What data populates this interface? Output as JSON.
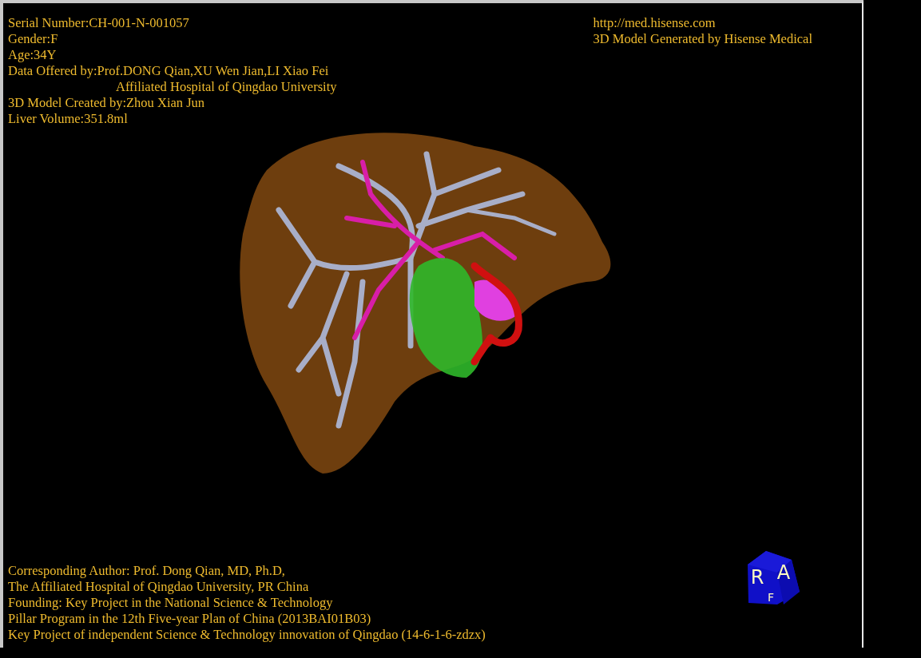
{
  "info_top_left": [
    {
      "text": "Serial Number:CH-001-N-001057",
      "indent": false
    },
    {
      "text": "Gender:F",
      "indent": false
    },
    {
      "text": "Age:34Y",
      "indent": false
    },
    {
      "text": "Data Offered by:Prof.DONG Qian,XU Wen Jian,LI Xiao Fei",
      "indent": false
    },
    {
      "text": "Affiliated Hospital of Qingdao University",
      "indent": true
    },
    {
      "text": "3D Model Created by:Zhou Xian Jun",
      "indent": false
    },
    {
      "text": "Liver Volume:351.8ml",
      "indent": false
    }
  ],
  "info_top_right": [
    "http://med.hisense.com",
    "3D Model Generated by Hisense Medical"
  ],
  "credits": [
    "Corresponding Author: Prof. Dong Qian, MD, Ph.D,",
    "The Affiliated Hospital of Qingdao University, PR China",
    "Founding: Key Project in the National Science & Technology",
    "Pillar Program in the 12th Five-year Plan of China (2013BAI01B03)",
    "Key Project of independent Science & Technology innovation of Qingdao (14-6-1-6-zdzx)"
  ],
  "orientation_cube": {
    "labels": [
      "R",
      "A",
      "F"
    ]
  }
}
